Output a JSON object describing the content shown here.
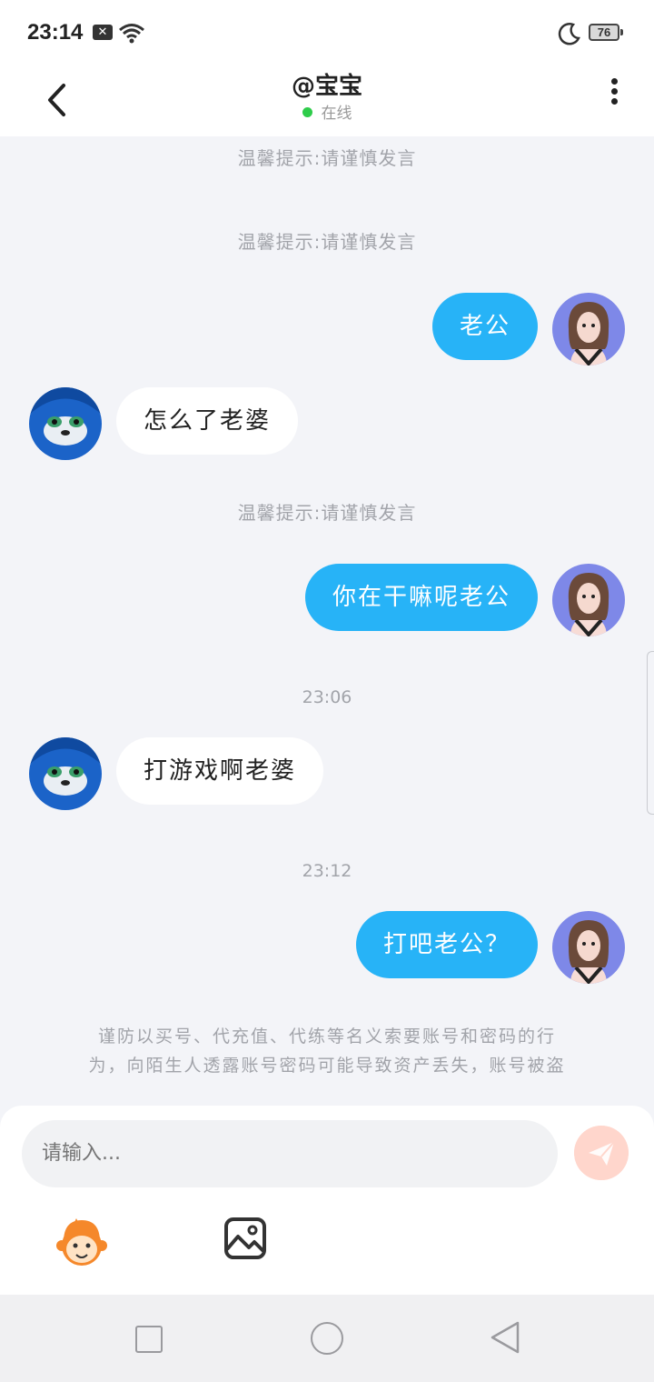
{
  "status_bar": {
    "time": "23:14",
    "notification_badge": "✕",
    "battery_level": "76",
    "icons": [
      "wifi-icon",
      "moon-icon",
      "battery-icon"
    ]
  },
  "header": {
    "title": "@宝宝",
    "status": "在线",
    "status_color": "#2ecc4a"
  },
  "chat": {
    "tips": [
      "温馨提示:请谨慎发言",
      "温馨提示:请谨慎发言",
      "温馨提示:请谨慎发言"
    ],
    "messages": [
      {
        "from": "me",
        "text": "老公"
      },
      {
        "from": "other",
        "text": "怎么了老婆"
      },
      {
        "from": "me",
        "text": "你在干嘛呢老公"
      },
      {
        "from": "other",
        "text": "打游戏啊老婆"
      },
      {
        "from": "me",
        "text": "打吧老公？"
      }
    ],
    "timestamps": [
      "23:06",
      "23:12"
    ],
    "warning_line1": "谨防以买号、代充值、代练等名义索要账号和密码的行",
    "warning_line2": "为，向陌生人透露账号密码可能导致资产丢失，账号被盗"
  },
  "composer": {
    "placeholder": "请输入...",
    "send_color": "#ffd6cc"
  },
  "colors": {
    "accent": "#27b3f7",
    "background": "#f3f4f8"
  }
}
